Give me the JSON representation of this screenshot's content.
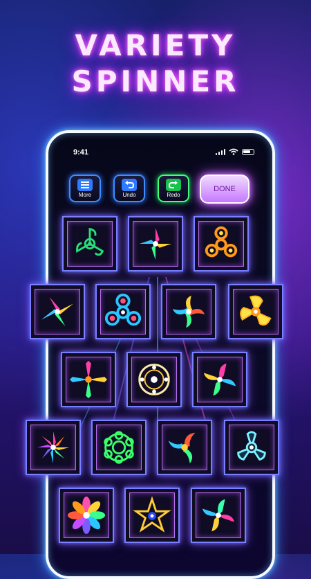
{
  "headline": {
    "line1": "VARIETY",
    "line2": "SPINNER"
  },
  "status_bar": {
    "time": "9:41"
  },
  "toolbar": {
    "more_label": "More",
    "undo_label": "Undo",
    "redo_label": "Redo",
    "done_label": "DONE"
  },
  "spinners": [
    {
      "name": "tri-blade-green",
      "color": "#26e07a"
    },
    {
      "name": "pinwheel-rainbow",
      "color": "#ff7a2a"
    },
    {
      "name": "tri-spinner-orange",
      "color": "#ff9a1a"
    },
    {
      "name": "star-rainbow",
      "color": "#ff3fa8"
    },
    {
      "name": "tri-spinner-blue",
      "color": "#29c6ff"
    },
    {
      "name": "shuriken-rainbow",
      "color": "#ffd23a"
    },
    {
      "name": "tri-spinner-yellow",
      "color": "#ffe14a"
    },
    {
      "name": "cross-rainbow",
      "color": "#3aff8a"
    },
    {
      "name": "wheel-white",
      "color": "#ffe9a8"
    },
    {
      "name": "blade-rainbow",
      "color": "#33c8ff"
    },
    {
      "name": "flower-rainbow",
      "color": "#ff4fb0"
    },
    {
      "name": "gear-green",
      "color": "#3aff6a"
    },
    {
      "name": "blade-spinner-rainbow",
      "color": "#ff5a3a"
    },
    {
      "name": "tri-spinner-cyan",
      "color": "#7af0ff"
    },
    {
      "name": "lotus-rainbow",
      "color": "#ff6ad0"
    },
    {
      "name": "star-gold",
      "color": "#ffcc33"
    },
    {
      "name": "blade-spinner-rainbow-2",
      "color": "#3affb0"
    }
  ]
}
